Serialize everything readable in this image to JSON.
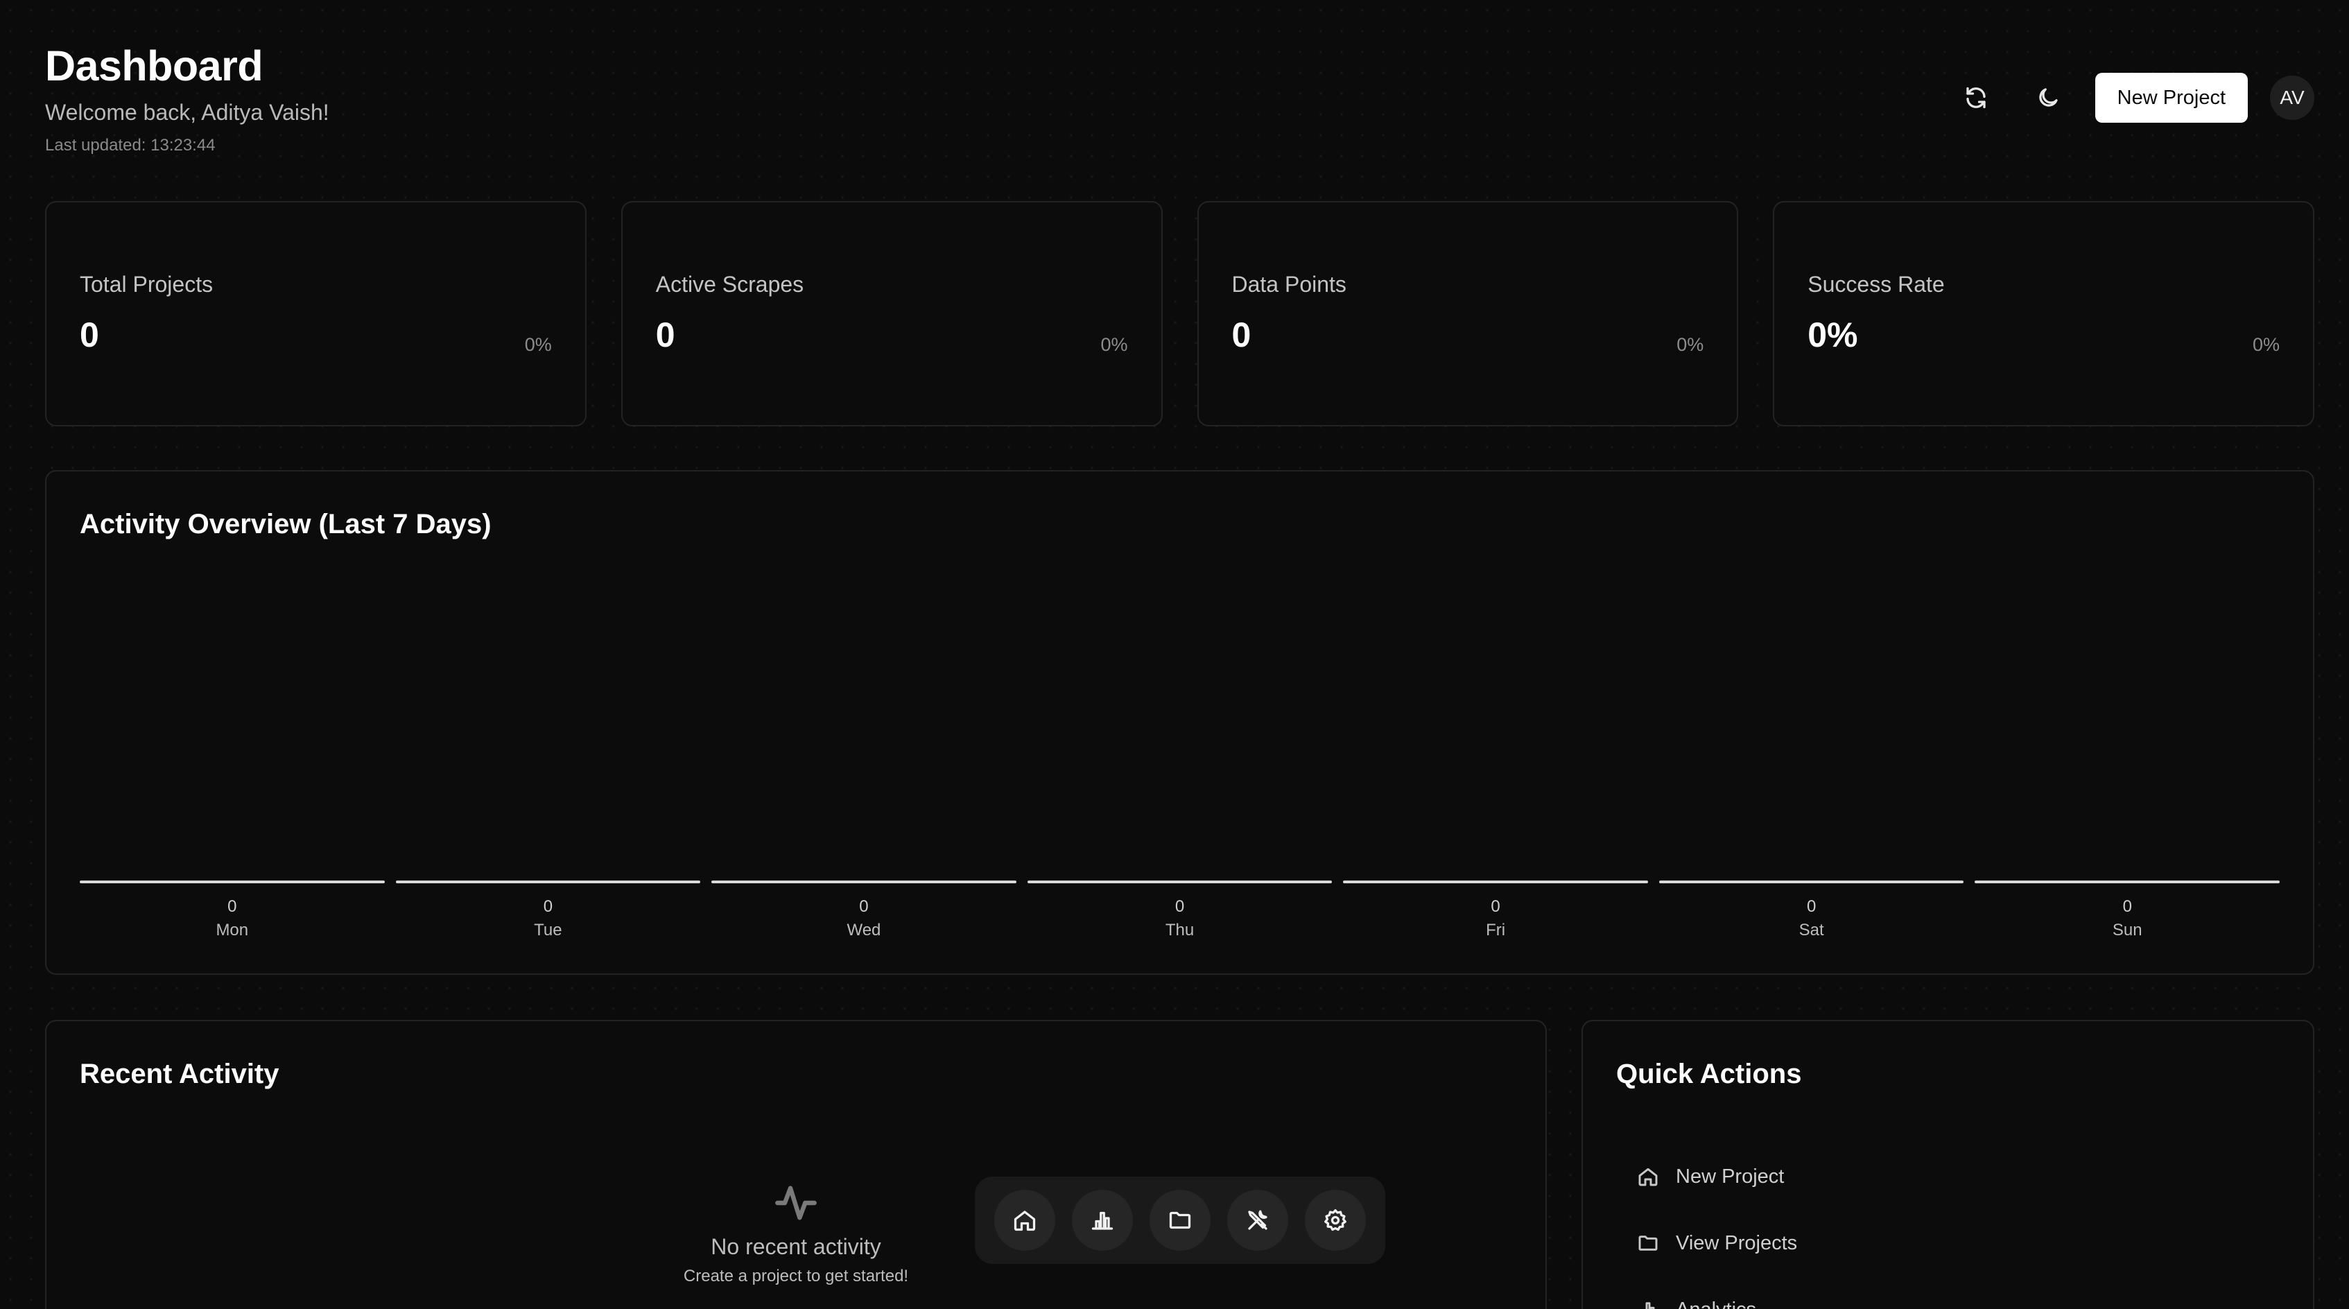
{
  "header": {
    "title": "Dashboard",
    "welcome": "Welcome back, Aditya Vaish!",
    "last_updated": "Last updated: 13:23:44",
    "new_project_label": "New Project",
    "avatar_initials": "AV"
  },
  "stats": [
    {
      "label": "Total Projects",
      "value": "0",
      "change": "0%"
    },
    {
      "label": "Active Scrapes",
      "value": "0",
      "change": "0%"
    },
    {
      "label": "Data Points",
      "value": "0",
      "change": "0%"
    },
    {
      "label": "Success Rate",
      "value": "0%",
      "change": "0%"
    }
  ],
  "activity": {
    "title": "Activity Overview (Last 7 Days)",
    "days": [
      {
        "day": "Mon",
        "value": "0"
      },
      {
        "day": "Tue",
        "value": "0"
      },
      {
        "day": "Wed",
        "value": "0"
      },
      {
        "day": "Thu",
        "value": "0"
      },
      {
        "day": "Fri",
        "value": "0"
      },
      {
        "day": "Sat",
        "value": "0"
      },
      {
        "day": "Sun",
        "value": "0"
      }
    ]
  },
  "recent": {
    "title": "Recent Activity",
    "empty_title": "No recent activity",
    "empty_sub": "Create a project to get started!"
  },
  "quick_actions": {
    "title": "Quick Actions",
    "items": [
      {
        "label": "New Project",
        "icon": "home-icon"
      },
      {
        "label": "View Projects",
        "icon": "folder-icon"
      },
      {
        "label": "Analytics",
        "icon": "bar-chart-icon"
      }
    ]
  },
  "dock": {
    "items": [
      "home-icon",
      "bar-chart-icon",
      "folder-icon",
      "tools-icon",
      "gear-icon"
    ]
  },
  "colors": {
    "background": "#0b0b0b",
    "card_border": "#232323",
    "accent_button": "#ffffff"
  }
}
